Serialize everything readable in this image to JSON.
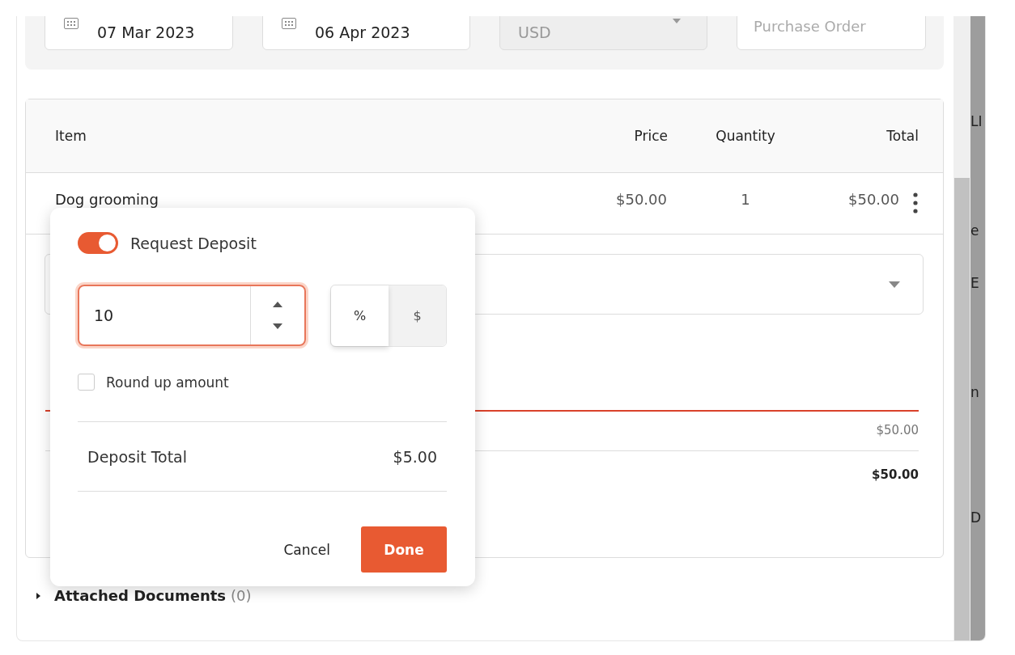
{
  "header_fields": [
    {
      "kind": "date",
      "value": "07 Mar 2023"
    },
    {
      "kind": "date",
      "value": "06 Apr 2023"
    },
    {
      "kind": "select",
      "value": "USD",
      "disabled": true
    },
    {
      "kind": "text",
      "placeholder": "Purchase Order"
    }
  ],
  "table": {
    "columns": [
      "Item",
      "Price",
      "Quantity",
      "Total"
    ],
    "rows": [
      {
        "item": "Dog grooming",
        "price": "$50.00",
        "quantity": "1",
        "total": "$50.00"
      }
    ]
  },
  "subtotal": "$50.00",
  "total": "$50.00",
  "attached_documents": {
    "label": "Attached Documents",
    "count": "(0)",
    "expanded": false
  },
  "side_panel_fragments": [
    "LI",
    "e",
    "E",
    "n",
    "D"
  ],
  "deposit_popup": {
    "toggle_label": "Request Deposit",
    "on": true,
    "amount": "10",
    "units": [
      {
        "label": "%",
        "selected": true
      },
      {
        "label": "$",
        "selected": false
      }
    ],
    "round_up": {
      "label": "Round up amount",
      "checked": false
    },
    "total_label": "Deposit Total",
    "total_value": "$5.00",
    "buttons": [
      {
        "kind": "secondary",
        "label": "Cancel"
      },
      {
        "kind": "primary",
        "label": "Done"
      }
    ]
  }
}
